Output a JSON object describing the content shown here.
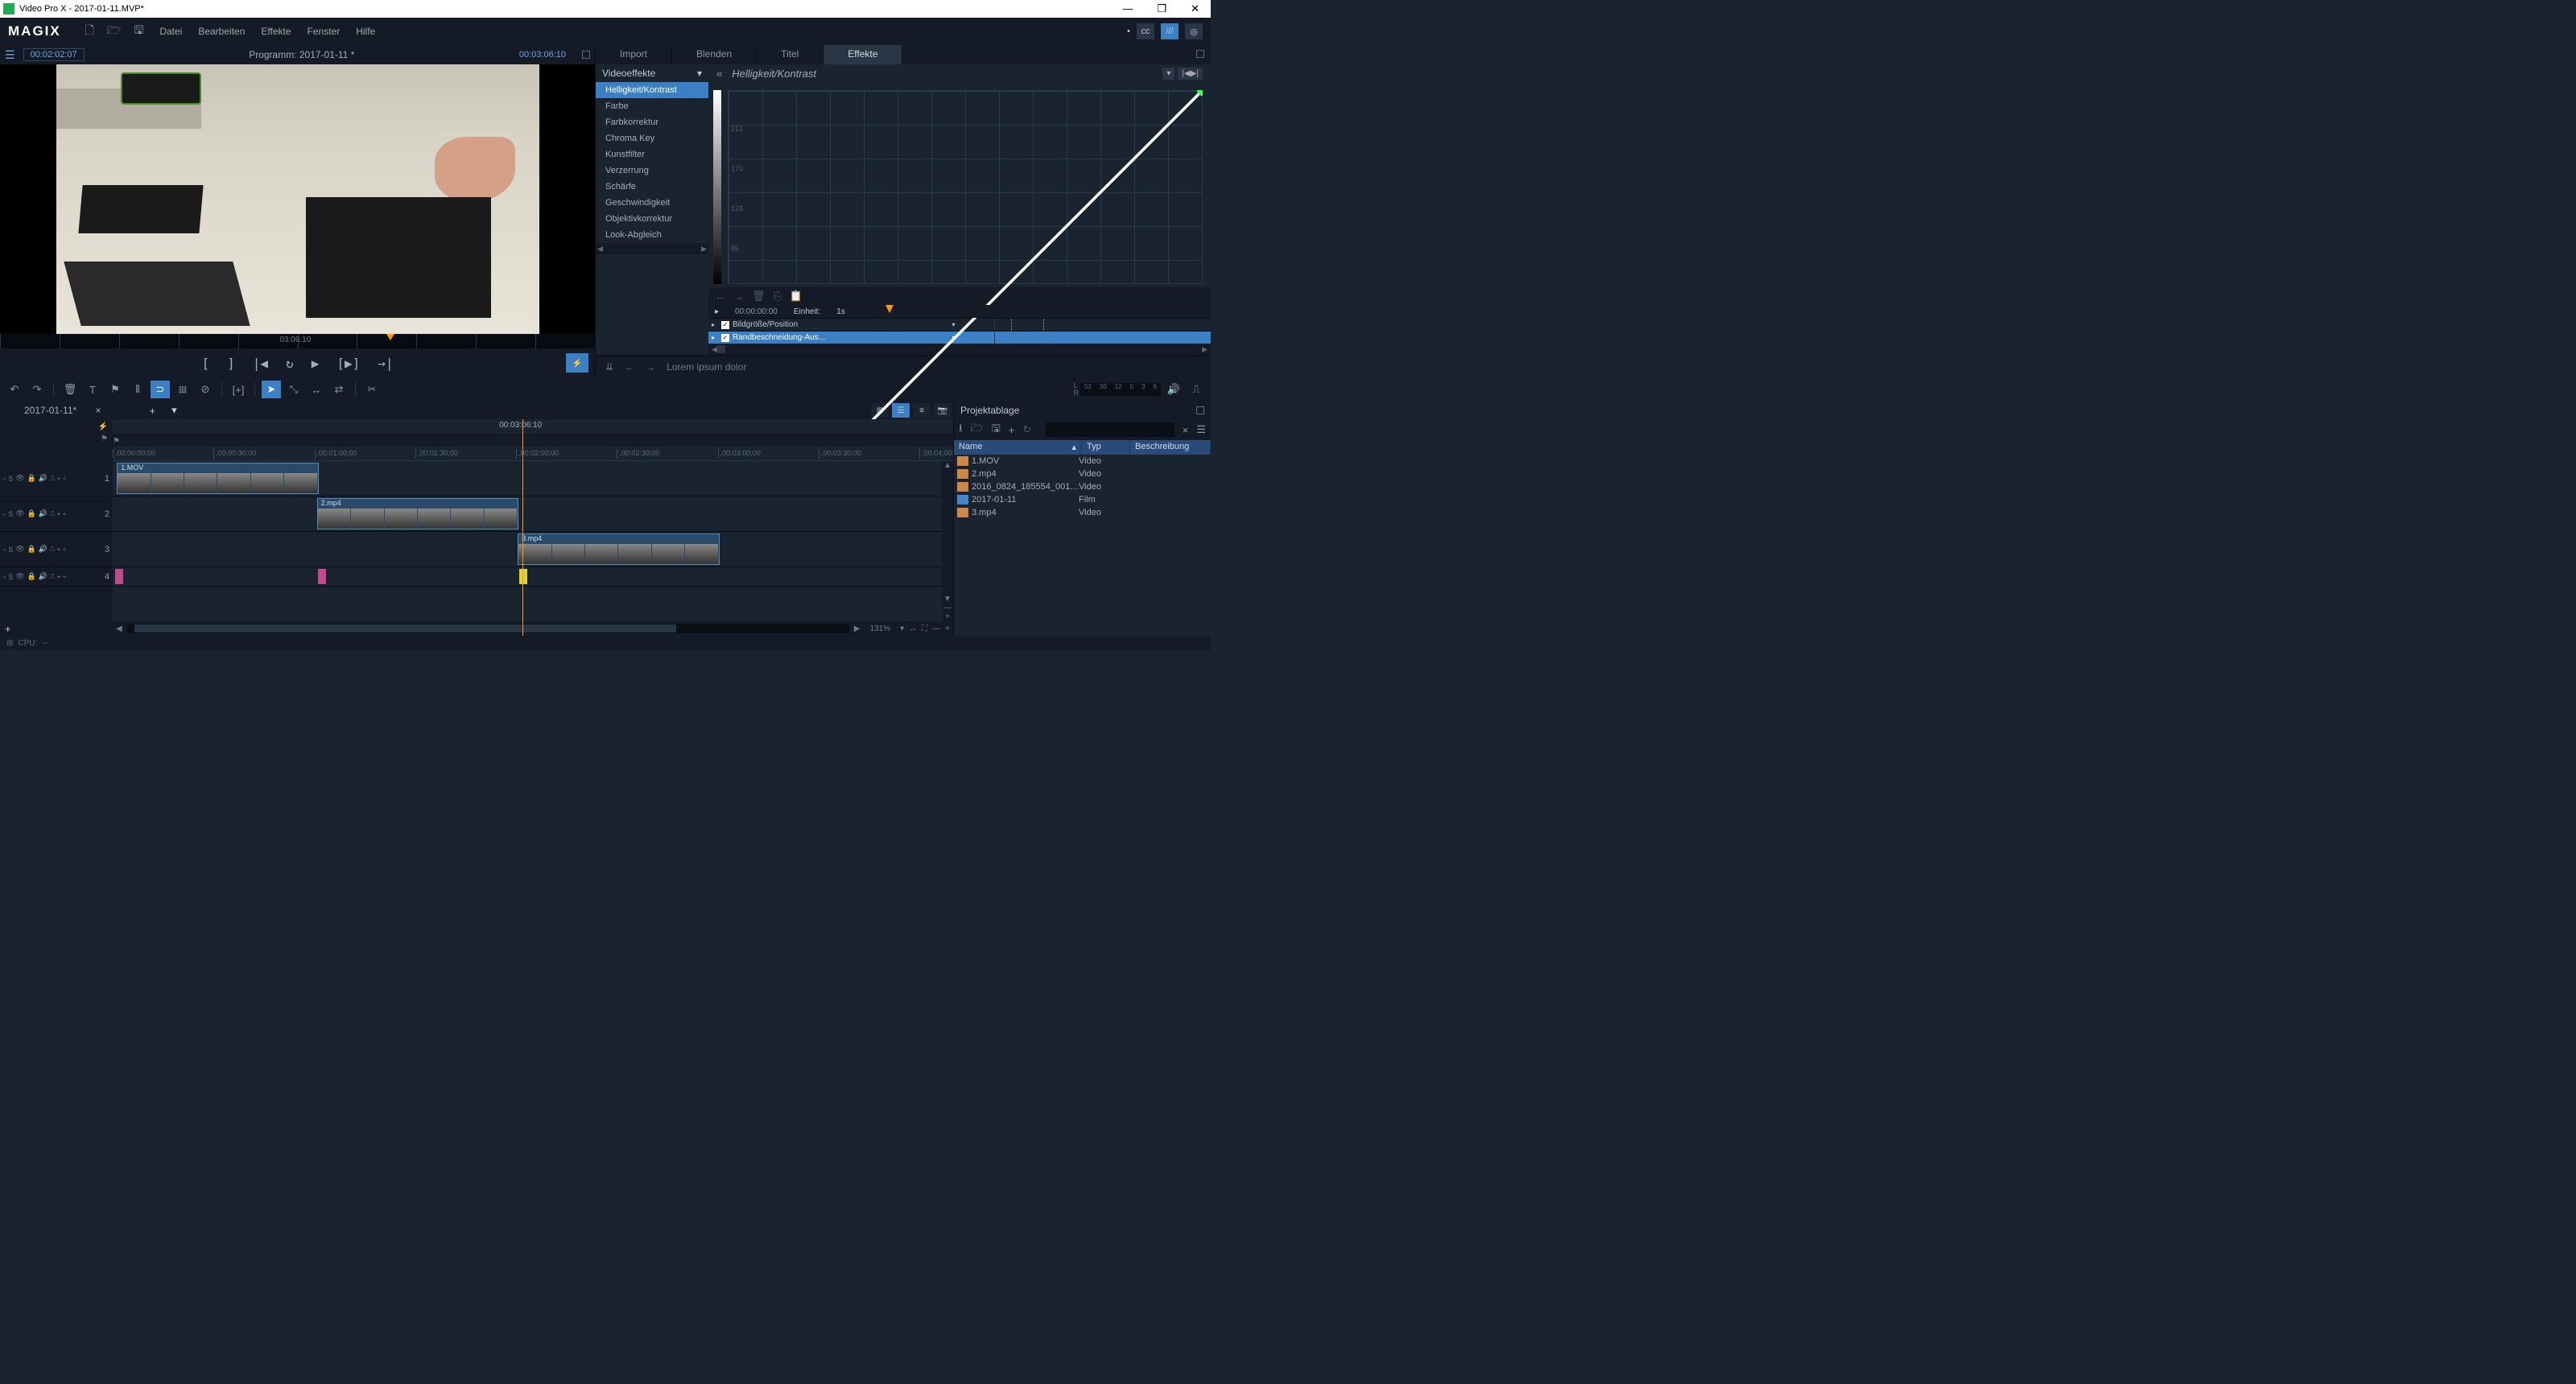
{
  "titlebar": {
    "text": "Video Pro X - 2017-01-11.MVP*"
  },
  "menubar": {
    "logo": "MAGIX",
    "items": [
      "Datei",
      "Bearbeiten",
      "Effekte",
      "Fenster",
      "Hilfe"
    ]
  },
  "preview": {
    "timecode1": "00:02:02:07",
    "program": "Programm: 2017-01-11 *",
    "timecode2": "00:03:06:10",
    "cursor_time": "03:06:10"
  },
  "fx": {
    "tabs": [
      "Import",
      "Blenden",
      "Titel",
      "Effekte"
    ],
    "active_tab": 3,
    "category": "Videoeffekte",
    "items": [
      "Helligkeit/Kontrast",
      "Farbe",
      "Farbkorrektur",
      "Chroma Key",
      "Kunstfilter",
      "Verzerrung",
      "Schärfe",
      "Geschwindigkeit",
      "Objektivkorrektur",
      "Look-Abgleich"
    ],
    "active_item": 0,
    "title": "Helligkeit/Kontrast",
    "grid_labels": [
      "213",
      "170",
      "128",
      "85"
    ],
    "param_header": {
      "time": "00:00:00:00",
      "unit_label": "Einheit:",
      "unit_value": "1s"
    },
    "params": [
      {
        "name": "Bildgröße/Position",
        "checked": true,
        "selected": false
      },
      {
        "name": "Randbeschneidung-Aus...",
        "checked": true,
        "selected": true
      }
    ]
  },
  "hints": {
    "text": "Lorem ipsum dolor"
  },
  "timeline": {
    "tab": "2017-01-11*",
    "playhead_time": "00:03:06:10",
    "playhead_pos_pct": 48.8,
    "ruler": [
      {
        "label": ",00:00:00;00",
        "pos": 0
      },
      {
        "label": ",00:00:30;00",
        "pos": 12
      },
      {
        "label": ",00:01:00;00",
        "pos": 24
      },
      {
        "label": ",00:01:30;00",
        "pos": 36
      },
      {
        "label": ",00:02:00;00",
        "pos": 48
      },
      {
        "label": ",00:02:30;00",
        "pos": 60
      },
      {
        "label": ",00:03:00;00",
        "pos": 72
      },
      {
        "label": ",00:03:30;00",
        "pos": 84
      },
      {
        "label": ",00:04:00;00",
        "pos": 96
      }
    ],
    "tracks": [
      {
        "num": "1",
        "clips": [
          {
            "name": "1.MOV",
            "left": 0.5,
            "width": 24
          }
        ]
      },
      {
        "num": "2",
        "clips": [
          {
            "name": "2.mp4",
            "left": 24.3,
            "width": 24
          }
        ]
      },
      {
        "num": "3",
        "clips": [
          {
            "name": "3.mp4",
            "left": 48.2,
            "width": 24
          }
        ]
      }
    ],
    "marker_track": {
      "num": "4",
      "markers": [
        {
          "pos": 0.3,
          "color": "m1"
        },
        {
          "pos": 24.4,
          "color": "m1"
        },
        {
          "pos": 48.4,
          "color": "m2"
        }
      ]
    },
    "zoom": "131%",
    "meter_ticks": [
      "52",
      "30",
      "12",
      "0",
      "3",
      "6"
    ]
  },
  "project_bin": {
    "title": "Projektablage",
    "cols": {
      "name": "Name",
      "typ": "Typ",
      "desc": "Beschreibung"
    },
    "rows": [
      {
        "name": "1.MOV",
        "typ": "Video",
        "icon": "vid"
      },
      {
        "name": "2.mp4",
        "typ": "Video",
        "icon": "vid"
      },
      {
        "name": "2016_0824_185554_001....",
        "typ": "Video",
        "icon": "vid"
      },
      {
        "name": "2017-01-11",
        "typ": "Film",
        "icon": "proj"
      },
      {
        "name": "3.mp4",
        "typ": "Video",
        "icon": "vid"
      }
    ]
  },
  "statusbar": {
    "cpu_label": "CPU:",
    "cpu_value": "--"
  }
}
